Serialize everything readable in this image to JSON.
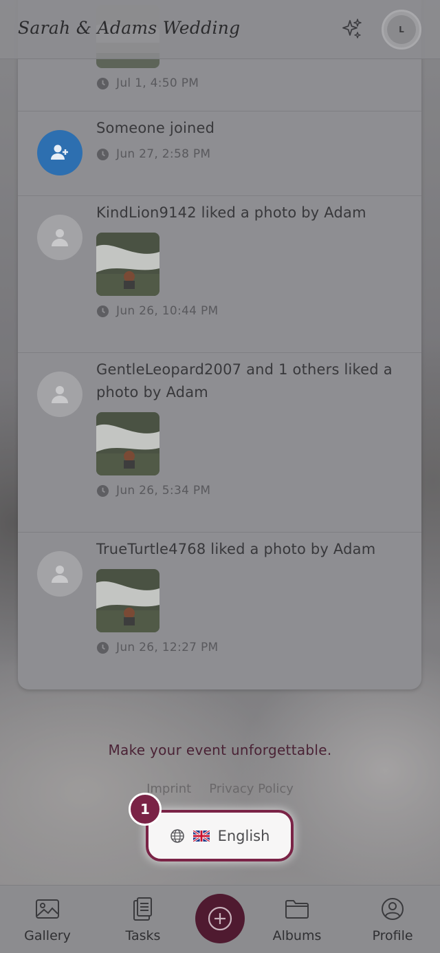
{
  "header": {
    "title": "Sarah & Adams Wedding",
    "avatar_initial": "L"
  },
  "activity": [
    {
      "text": "",
      "time": "Jul 1, 4:50 PM",
      "avatar": "user-icon",
      "has_photo": true
    },
    {
      "text": "Someone joined",
      "time": "Jun 27, 2:58 PM",
      "avatar": "user-add-icon",
      "has_photo": false
    },
    {
      "text": "KindLion9142 liked a photo by Adam",
      "time": "Jun 26, 10:44 PM",
      "avatar": "user-icon",
      "has_photo": true
    },
    {
      "text": "GentleLeopard2007 and 1 others liked a photo by Adam",
      "time": "Jun 26, 5:34 PM",
      "avatar": "user-icon",
      "has_photo": true
    },
    {
      "text": "TrueTurtle4768 liked a photo by Adam",
      "time": "Jun 26, 12:27 PM",
      "avatar": "user-icon",
      "has_photo": true
    }
  ],
  "footer": {
    "tagline": "Make your event unforgettable.",
    "imprint": "Imprint",
    "privacy": "Privacy Policy",
    "language": "English",
    "badge_number": "1"
  },
  "nav": {
    "gallery": "Gallery",
    "tasks": "Tasks",
    "albums": "Albums",
    "profile": "Profile"
  },
  "colors": {
    "accent": "#7a2346",
    "fab": "#4f1a30",
    "join_avatar": "#2d6fb0"
  }
}
